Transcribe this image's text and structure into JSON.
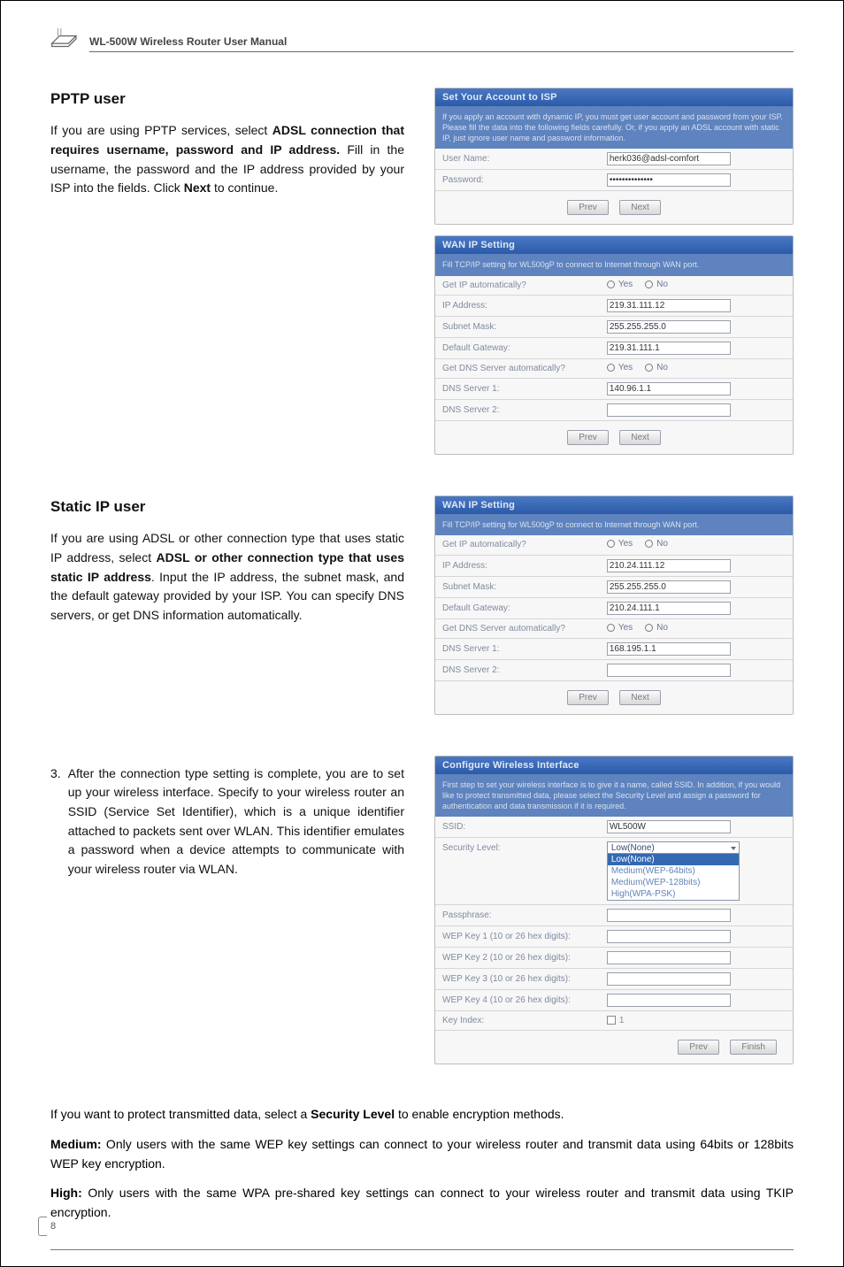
{
  "header": {
    "product_title": "WL-500W Wireless Router User Manual"
  },
  "pptp_section": {
    "heading": "PPTP user",
    "body_html": "If you are using PPTP services, select <b>ADSL connection that requires username, password and IP address.</b> Fill in the username, the password and the IP address provided by your ISP into the fields. Click <b>Next</b> to continue."
  },
  "static_section": {
    "heading": "Static IP user",
    "body_html": "If you are using ADSL or other connection type that uses static IP address, select <b>ADSL or other connection type that uses static IP address</b>. Input the IP address, the subnet mask, and the default gateway provided by your ISP. You can specify DNS servers, or get DNS information automatically."
  },
  "step3": {
    "num": "3.",
    "body": "After the connection type setting is complete, you are to set up your wireless interface. Specify to your wireless router an SSID (Service Set Identifier), which is a unique identifier attached to packets sent over WLAN. This identifier emulates a password when a device attempts to communicate with your wireless router via WLAN."
  },
  "card_account": {
    "title": "Set Your Account to ISP",
    "desc": "If you apply an account with dynamic IP, you must get user account and password from your ISP. Please fill the data into the following fields carefully. Or, if you apply an ADSL account with static IP, just ignore user name and password information.",
    "rows": {
      "user_label": "User Name:",
      "user_value": "herk036@adsl-comfort",
      "pass_label": "Password:",
      "pass_value": "••••••••••••••"
    },
    "btn_prev": "Prev",
    "btn_next": "Next"
  },
  "card_wan1": {
    "title": "WAN IP Setting",
    "desc": "Fill TCP/IP setting for WL500gP to connect to Internet through WAN port.",
    "rows": {
      "auto_label": "Get IP automatically?",
      "ip_label": "IP Address:",
      "ip_value": "219.31.111.12",
      "mask_label": "Subnet Mask:",
      "mask_value": "255.255.255.0",
      "gw_label": "Default Gateway:",
      "gw_value": "219.31.111.1",
      "dnsauto_label": "Get DNS Server automatically?",
      "dns1_label": "DNS Server 1:",
      "dns1_value": "140.96.1.1",
      "dns2_label": "DNS Server 2:",
      "dns2_value": ""
    },
    "radio_yes": "Yes",
    "radio_no": "No",
    "btn_prev": "Prev",
    "btn_next": "Next"
  },
  "card_wan2": {
    "title": "WAN IP Setting",
    "desc": "Fill TCP/IP setting for WL500gP to connect to Internet through WAN port.",
    "rows": {
      "auto_label": "Get IP automatically?",
      "ip_label": "IP Address:",
      "ip_value": "210.24.111.12",
      "mask_label": "Subnet Mask:",
      "mask_value": "255.255.255.0",
      "gw_label": "Default Gateway:",
      "gw_value": "210.24.111.1",
      "dnsauto_label": "Get DNS Server automatically?",
      "dns1_label": "DNS Server 1:",
      "dns1_value": "168.195.1.1",
      "dns2_label": "DNS Server 2:",
      "dns2_value": ""
    },
    "radio_yes": "Yes",
    "radio_no": "No",
    "btn_prev": "Prev",
    "btn_next": "Next"
  },
  "card_wifi": {
    "title": "Configure Wireless Interface",
    "desc": "First step to set your wireless interface is to give it a name, called SSID. In addition, if you would like to protect transmitted data, please select the Security Level and assign a password for authentication and data transmission if it is required.",
    "rows": {
      "ssid_label": "SSID:",
      "ssid_value": "WL500W",
      "sec_label": "Security Level:",
      "sec_selected": "Low(None)",
      "sec_options": [
        "Low(None)",
        "Medium(WEP-64bits)",
        "Medium(WEP-128bits)",
        "High(WPA-PSK)"
      ],
      "pass_label": "Passphrase:",
      "pass_value": "",
      "k1_label": "WEP Key 1 (10 or 26 hex digits):",
      "k1_value": "",
      "k2_label": "WEP Key 2 (10 or 26 hex digits):",
      "k2_value": "",
      "k3_label": "WEP Key 3 (10 or 26 hex digits):",
      "k3_value": "",
      "k4_label": "WEP Key 4 (10 or 26 hex digits):",
      "k4_value": "",
      "ki_label": "Key Index:",
      "ki_value": "1"
    },
    "btn_prev": "Prev",
    "btn_finish": "Finish"
  },
  "bottom": {
    "p1_html": "If you want to protect transmitted data, select a <b>Security Level</b> to enable encryption methods.",
    "p2_html": "<b>Medium:</b> Only users with the same WEP key settings can connect to your wireless router and transmit data using 64bits or 128bits WEP key encryption.",
    "p3_html": "<b>High:</b> Only users with the same WPA pre-shared key settings can connect to your wireless router and transmit data using TKIP encryption."
  },
  "page_number": "8"
}
